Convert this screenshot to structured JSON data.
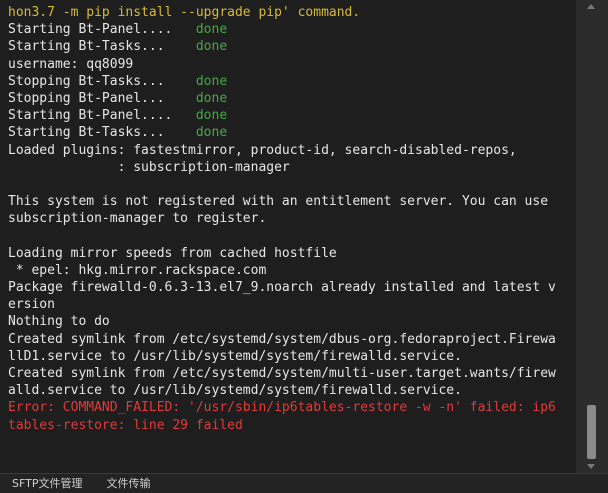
{
  "terminal": {
    "lines": [
      [
        {
          "t": "hon3.7 -m pip install --upgrade pip' command.",
          "c": "yellow"
        }
      ],
      [
        {
          "t": "Starting Bt-Panel....   ",
          "c": "white"
        },
        {
          "t": "done",
          "c": "green"
        }
      ],
      [
        {
          "t": "Starting Bt-Tasks...    ",
          "c": "white"
        },
        {
          "t": "done",
          "c": "green"
        }
      ],
      [
        {
          "t": "username: qq8099",
          "c": "white"
        }
      ],
      [
        {
          "t": "Stopping Bt-Tasks...    ",
          "c": "white"
        },
        {
          "t": "done",
          "c": "green"
        }
      ],
      [
        {
          "t": "Stopping Bt-Panel...    ",
          "c": "white"
        },
        {
          "t": "done",
          "c": "green"
        }
      ],
      [
        {
          "t": "Starting Bt-Panel....   ",
          "c": "white"
        },
        {
          "t": "done",
          "c": "green"
        }
      ],
      [
        {
          "t": "Starting Bt-Tasks...    ",
          "c": "white"
        },
        {
          "t": "done",
          "c": "green"
        }
      ],
      [
        {
          "t": "Loaded plugins: fastestmirror, product-id, search-disabled-repos,",
          "c": "white"
        }
      ],
      [
        {
          "t": "              : subscription-manager",
          "c": "white"
        }
      ],
      [
        {
          "t": "",
          "c": "white"
        }
      ],
      [
        {
          "t": "This system is not registered with an entitlement server. You can use",
          "c": "white"
        }
      ],
      [
        {
          "t": "subscription-manager to register.",
          "c": "white"
        }
      ],
      [
        {
          "t": "",
          "c": "white"
        }
      ],
      [
        {
          "t": "Loading mirror speeds from cached hostfile",
          "c": "white"
        }
      ],
      [
        {
          "t": " * epel: hkg.mirror.rackspace.com",
          "c": "white"
        }
      ],
      [
        {
          "t": "Package firewalld-0.6.3-13.el7_9.noarch already installed and latest v",
          "c": "white"
        }
      ],
      [
        {
          "t": "ersion",
          "c": "white"
        }
      ],
      [
        {
          "t": "Nothing to do",
          "c": "white"
        }
      ],
      [
        {
          "t": "Created symlink from /etc/systemd/system/dbus-org.fedoraproject.Firewa",
          "c": "white"
        }
      ],
      [
        {
          "t": "llD1.service to /usr/lib/systemd/system/firewalld.service.",
          "c": "white"
        }
      ],
      [
        {
          "t": "Created symlink from /etc/systemd/system/multi-user.target.wants/firew",
          "c": "white"
        }
      ],
      [
        {
          "t": "alld.service to /usr/lib/systemd/system/firewalld.service.",
          "c": "white"
        }
      ],
      [
        {
          "t": "Error: COMMAND_FAILED: '/usr/sbin/ip6tables-restore -w -n' failed: ip6",
          "c": "red"
        }
      ],
      [
        {
          "t": "tables-restore: line 29 failed",
          "c": "red"
        }
      ],
      [
        {
          "t": "",
          "c": "white"
        }
      ],
      [
        {
          "t": "",
          "c": "white"
        }
      ],
      [
        {
          "t": "=================================================================",
          "c": "white"
        }
      ]
    ]
  },
  "bottom_bar": {
    "tabs": [
      {
        "label": "SFTP文件管理"
      },
      {
        "label": "文件传输"
      }
    ]
  },
  "colors": {
    "background": "#1e1e1e",
    "text": "#e6e6e6",
    "yellow": "#d7ba3b",
    "green": "#44aa44",
    "red": "#e03b3b"
  }
}
